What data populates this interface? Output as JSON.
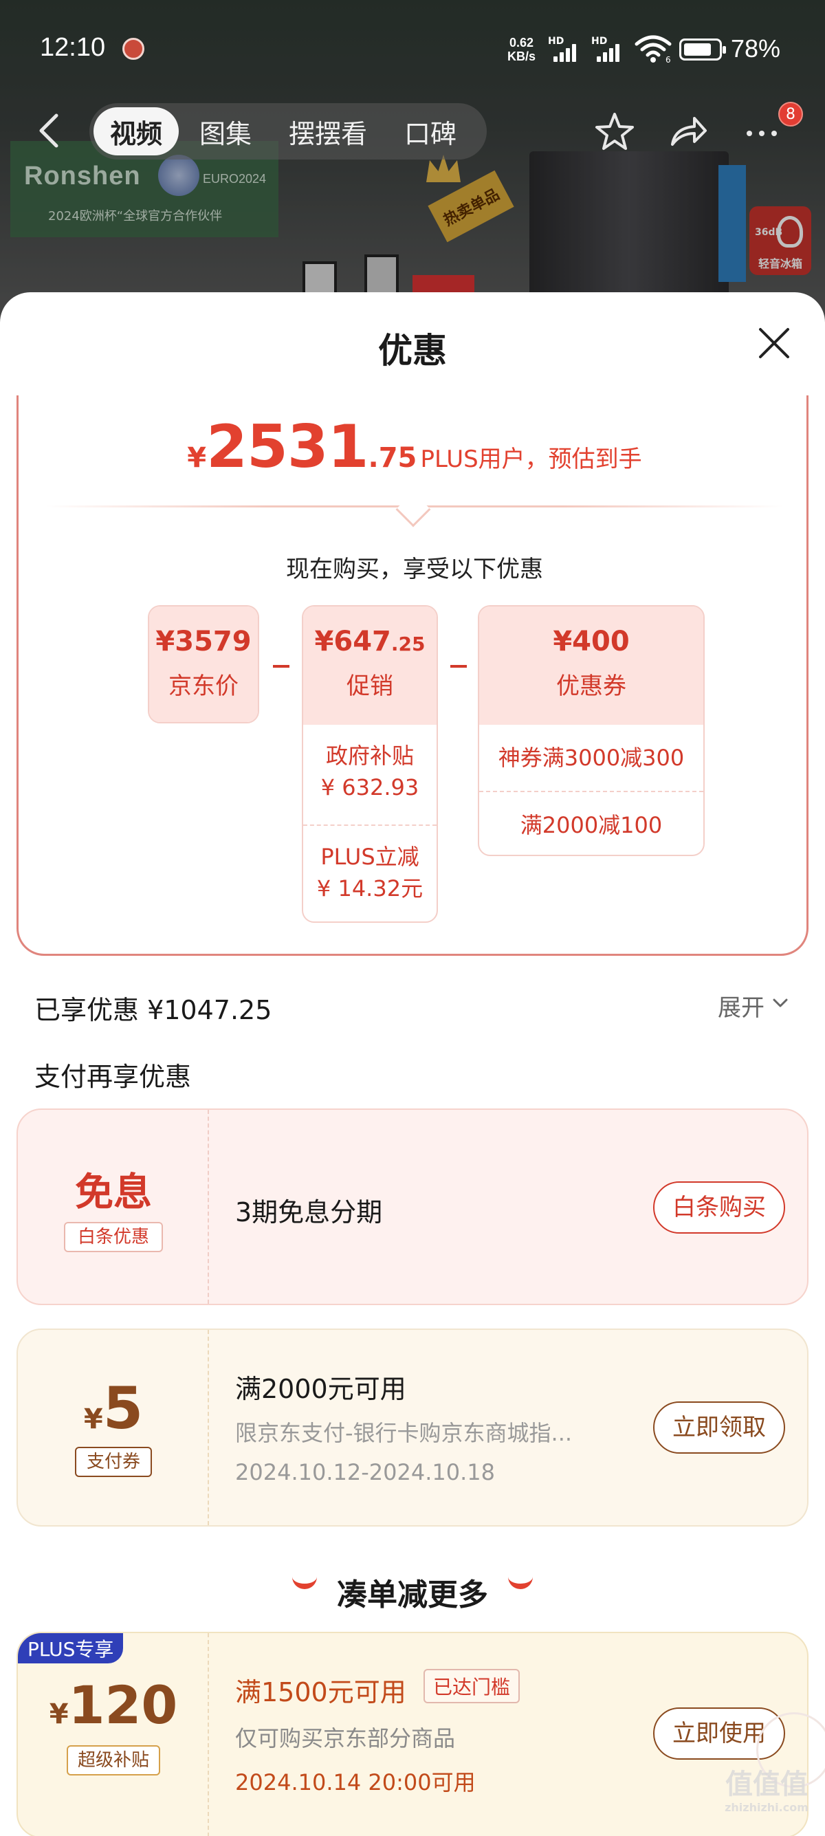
{
  "status_bar": {
    "time": "12:10",
    "speed_value": "0.62",
    "speed_unit": "KB/s",
    "network1": "HD",
    "network2": "HD",
    "wifi_sub": "6",
    "battery": "78%",
    "battery_level_pct": 78
  },
  "background": {
    "brand": "Ronshen",
    "euro": "EURO2024",
    "partner": "2024欧洲杯“全球官方合作伙伴",
    "hot_label": "热卖单品",
    "badge_db": "36dB",
    "badge_label": "轻音冰箱"
  },
  "nav": {
    "tabs": [
      {
        "label": "视频",
        "active": true
      },
      {
        "label": "图集",
        "active": false
      },
      {
        "label": "摆摆看",
        "active": false
      },
      {
        "label": "口碑",
        "active": false
      }
    ],
    "more_badge": "8",
    "icons": {
      "back": "back-arrow-icon",
      "favorite": "star-icon",
      "share": "share-icon",
      "more": "more-icon"
    }
  },
  "sheet": {
    "title": "优惠",
    "close_icon": "close-icon"
  },
  "price": {
    "currency": "¥",
    "integer": "2531",
    "decimal": ".75",
    "note": "PLUS用户，预估到手",
    "now_buy": "现在购买，享受以下优惠"
  },
  "breakdown": {
    "jd": {
      "value": "¥3579",
      "label": "京东价"
    },
    "promo": {
      "value_int": "¥647",
      "value_dec": ".25",
      "label": "促销",
      "items": [
        {
          "name": "政府补贴",
          "amount": "¥ 632.93"
        },
        {
          "name": "PLUS立减",
          "amount": "¥ 14.32元"
        }
      ]
    },
    "coupon": {
      "value": "¥400",
      "label": "优惠券",
      "items": [
        "神券满3000减300",
        "满2000减100"
      ]
    }
  },
  "enjoyed": {
    "label": "已享优惠 ¥1047.25",
    "expand": "展开"
  },
  "pay_more": "支付再享优惠",
  "offers": [
    {
      "main": "免息",
      "tag": "白条优惠",
      "title": "3期免息分期",
      "button": "白条购买"
    },
    {
      "currency": "¥",
      "amount": "5",
      "tag": "支付券",
      "title": "满2000元可用",
      "desc": "限京东支付-银行卡购京东商城指...",
      "date": "2024.10.12-2024.10.18",
      "button": "立即领取"
    }
  ],
  "bundle_title": "凑单减更多",
  "plus_offer": {
    "badge": "PLUS专享",
    "currency": "¥",
    "amount": "120",
    "tag": "超级补贴",
    "title": "满1500元可用",
    "reached": "已达门槛",
    "desc": "仅可购买京东部分商品",
    "date": "2024.10.14 20:00可用",
    "button": "立即使用"
  },
  "watermark": {
    "text": "值",
    "site": "zhizhizhi.com"
  },
  "colors": {
    "accent_red": "#e2412f",
    "card_pink": "#fde3df",
    "cream": "#fdf7ec",
    "brown": "#8a4a1f",
    "plus_blue": "#2f3fb8"
  }
}
